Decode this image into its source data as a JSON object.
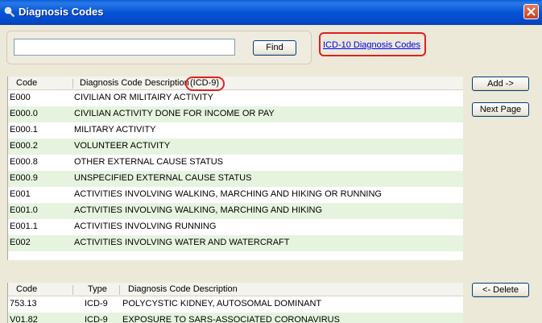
{
  "window": {
    "title": "Diagnosis Codes"
  },
  "search": {
    "value": "",
    "find_label": "Find",
    "icd10_link": "ICD-10 Diagnosis Codes"
  },
  "top_grid": {
    "col_code": "Code",
    "col_desc": "Diagnosis Code Description",
    "col_desc_suffix": "(ICD-9)",
    "rows": [
      {
        "code": "E000",
        "desc": "CIVILIAN OR MILITAIRY ACTIVITY"
      },
      {
        "code": "E000.0",
        "desc": "CIVILIAN ACTIVITY DONE FOR INCOME OR PAY"
      },
      {
        "code": "E000.1",
        "desc": "MILITARY ACTIVITY"
      },
      {
        "code": "E000.2",
        "desc": "VOLUNTEER ACTIVITY"
      },
      {
        "code": "E000.8",
        "desc": "OTHER EXTERNAL CAUSE STATUS"
      },
      {
        "code": "E000.9",
        "desc": "UNSPECIFIED EXTERNAL CAUSE STATUS"
      },
      {
        "code": "E001",
        "desc": "ACTIVITIES INVOLVING WALKING, MARCHING AND HIKING OR RUNNING"
      },
      {
        "code": "E001.0",
        "desc": "ACTIVITIES INVOLVING WALKING, MARCHING AND HIKING"
      },
      {
        "code": "E001.1",
        "desc": "ACTIVITIES INVOLVING RUNNING"
      },
      {
        "code": "E002",
        "desc": "ACTIVITIES INVOLVING WATER AND WATERCRAFT"
      }
    ]
  },
  "buttons": {
    "add": "Add ->",
    "next_page": "Next Page",
    "delete": "<- Delete"
  },
  "bottom_grid": {
    "col_code": "Code",
    "col_type": "Type",
    "col_desc": "Diagnosis Code Description",
    "rows": [
      {
        "code": "753.13",
        "type": "ICD-9",
        "desc": "POLYCYSTIC KIDNEY, AUTOSOMAL DOMINANT"
      },
      {
        "code": "V01.82",
        "type": "ICD-9",
        "desc": "EXPOSURE TO SARS-ASSOCIATED CORONAVIRUS"
      }
    ]
  },
  "colors": {
    "title_bar": "#0554d6",
    "row_alt": "#e6f4df",
    "highlight": "#e02020"
  }
}
